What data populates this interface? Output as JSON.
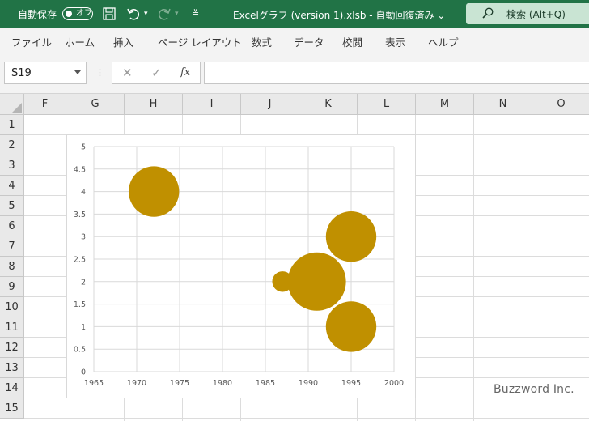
{
  "titlebar": {
    "autosave_label": "自動保存",
    "autosave_state": "オフ",
    "doc_title": "Excelグラフ (version 1).xlsb  -  自動回復済み ⌄",
    "search_label": "検索 (Alt+Q)"
  },
  "ribbon": {
    "tabs": [
      "ファイル",
      "ホーム",
      "挿入",
      "ページ レイアウト",
      "数式",
      "データ",
      "校閲",
      "表示",
      "ヘルプ"
    ]
  },
  "formula_bar": {
    "name_box": "S19",
    "cancel_symbol": "✕",
    "enter_symbol": "✓",
    "fx_symbol": "fx",
    "formula": ""
  },
  "sheet": {
    "columns": [
      "F",
      "G",
      "H",
      "I",
      "J",
      "K",
      "L",
      "M",
      "N",
      "O"
    ],
    "rows": [
      "1",
      "2",
      "3",
      "4",
      "5",
      "6",
      "7",
      "8",
      "9",
      "10",
      "11",
      "12",
      "13",
      "14",
      "15"
    ]
  },
  "colors": {
    "excel_green": "#217346",
    "bubble": "#C09000"
  },
  "watermark": "Buzzword Inc.",
  "chart_data": {
    "type": "scatter",
    "subtype": "bubble",
    "title": "",
    "xlabel": "",
    "ylabel": "",
    "xlim": [
      1965,
      2000
    ],
    "ylim": [
      0,
      5
    ],
    "xticks": [
      "1965",
      "1970",
      "1975",
      "1980",
      "1985",
      "1990",
      "1995",
      "2000"
    ],
    "yticks": [
      "0",
      "0.5",
      "1",
      "1.5",
      "2",
      "2.5",
      "3",
      "3.5",
      "4",
      "4.5",
      "5"
    ],
    "grid": true,
    "legend": "none",
    "series": [
      {
        "points": [
          {
            "x": 1972,
            "y": 4,
            "size": 3
          },
          {
            "x": 1987,
            "y": 2,
            "size": 0.5
          },
          {
            "x": 1991,
            "y": 2,
            "size": 4
          },
          {
            "x": 1995,
            "y": 3,
            "size": 3
          },
          {
            "x": 1995,
            "y": 1,
            "size": 3
          }
        ]
      }
    ]
  }
}
